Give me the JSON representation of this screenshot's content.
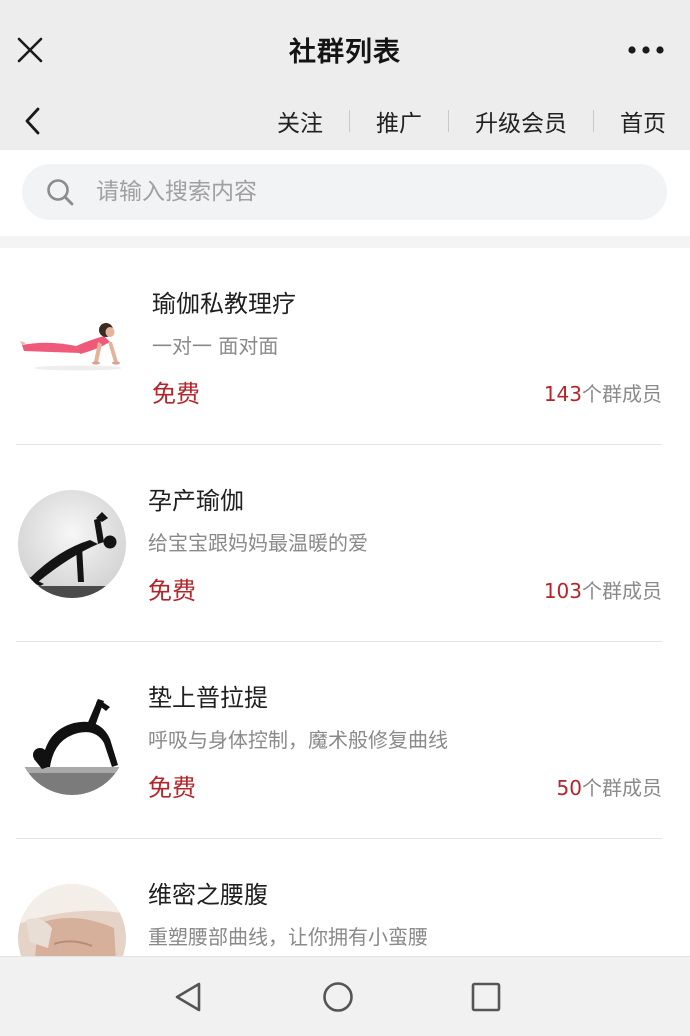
{
  "header": {
    "title": "社群列表",
    "close_icon": "close-icon",
    "more_icon": "more-dots-icon"
  },
  "nav": {
    "back_icon": "chevron-left-icon",
    "links": [
      "关注",
      "推广",
      "升级会员",
      "首页"
    ]
  },
  "search": {
    "placeholder": "请输入搜索内容",
    "value": "",
    "icon": "search-icon"
  },
  "groups": [
    {
      "name": "瑜伽私教理疗",
      "description": "一对一 面对面",
      "price": "免费",
      "member_count": "143",
      "member_suffix": "个群成员",
      "thumbnail": "yoga-pose-photo"
    },
    {
      "name": "孕产瑜伽",
      "description": "给宝宝跟妈妈最温暖的爱",
      "price": "免费",
      "member_count": "103",
      "member_suffix": "个群成员",
      "thumbnail": "yoga-silhouette-photo"
    },
    {
      "name": "垫上普拉提",
      "description": "呼吸与身体控制，魔术般修复曲线",
      "price": "免费",
      "member_count": "50",
      "member_suffix": "个群成员",
      "thumbnail": "pilates-silhouette-photo"
    },
    {
      "name": "维密之腰腹",
      "description": "重塑腰部曲线，让你拥有小蛮腰",
      "price": "免费",
      "member_count": "",
      "member_suffix": "",
      "thumbnail": "waist-photo"
    }
  ],
  "system_nav": {
    "back_icon": "triangle-back-icon",
    "home_icon": "circle-home-icon",
    "recents_icon": "square-recents-icon"
  },
  "colors": {
    "bar_bg": "#ededed",
    "accent_red": "#b4252b",
    "muted_text": "#8a8a8a"
  }
}
